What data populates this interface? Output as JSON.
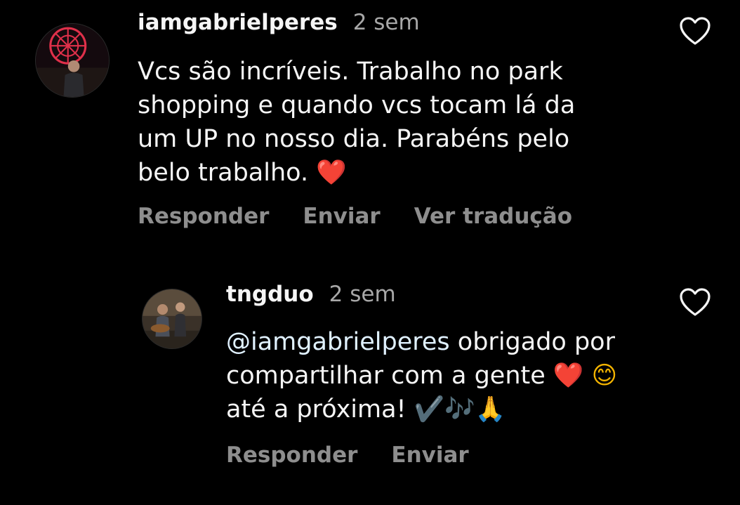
{
  "comments": [
    {
      "username": "iamgabrielperes",
      "time": "2 sem",
      "lines": [
        "Vcs são incríveis. Trabalho no park",
        "shopping e quando vcs tocam lá da",
        "um UP no nosso dia. Parabéns pelo",
        "belo trabalho."
      ],
      "emojis": [
        "❤️"
      ],
      "actions": [
        "Responder",
        "Enviar",
        "Ver tradução"
      ]
    },
    {
      "username": "tngduo",
      "time": "2 sem",
      "mention": "@iamgabrielperes",
      "lines": [
        " obrigado por",
        "compartilhar com a gente",
        "até a próxima!"
      ],
      "emojis_line2": [
        "❤️",
        "😊"
      ],
      "emojis_line3": [
        "✔️",
        "🎶",
        "🙏"
      ],
      "actions": [
        "Responder",
        "Enviar"
      ]
    }
  ],
  "colors": {
    "background": "#000000",
    "text": "#f5f5f5",
    "secondary": "#a8a8a8",
    "action": "#8e8e8e"
  },
  "icons": {
    "like": "heart-outline-icon"
  }
}
